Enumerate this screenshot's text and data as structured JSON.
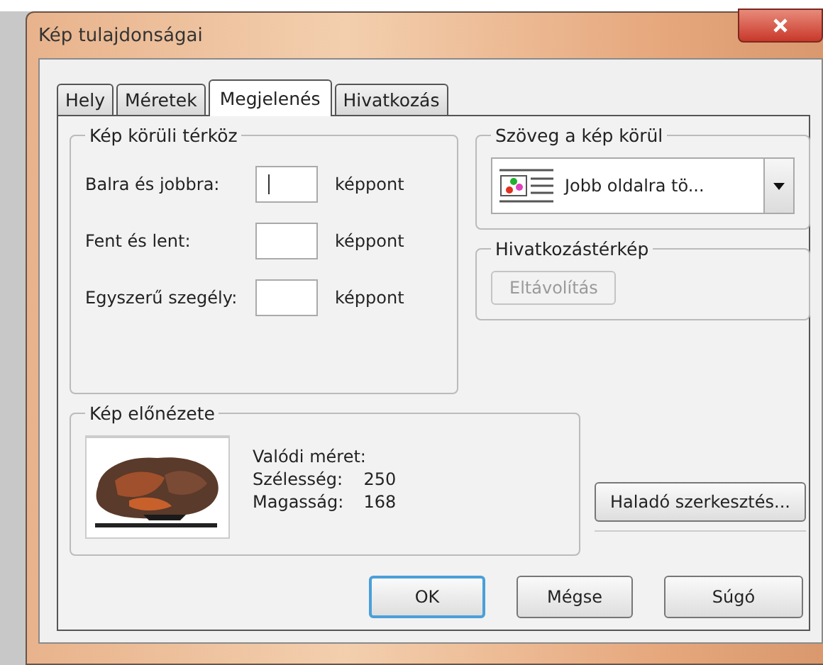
{
  "window": {
    "title": "Kép tulajdonságai"
  },
  "tabs": [
    {
      "label": "Hely",
      "selected": false
    },
    {
      "label": "Méretek",
      "selected": false
    },
    {
      "label": "Megjelenés",
      "selected": true
    },
    {
      "label": "Hivatkozás",
      "selected": false
    }
  ],
  "spacing_group": {
    "title": "Kép körüli térköz",
    "rows": [
      {
        "label": "Balra és jobbra:",
        "focused": true,
        "unit": "képpont"
      },
      {
        "label": "Fent és lent:",
        "focused": false,
        "unit": "képpont"
      },
      {
        "label": "Egyszerű szegély:",
        "focused": false,
        "unit": "képpont"
      }
    ]
  },
  "wrap_group": {
    "title": "Szöveg a kép körül",
    "dropdown_value": "Jobb oldalra tö..."
  },
  "imagemap_group": {
    "title": "Hivatkozástérkép",
    "button": {
      "label": "Eltávolítás",
      "disabled": true
    }
  },
  "preview_group": {
    "title": "Kép előnézete",
    "real_size_label": "Valódi méret:",
    "fields": [
      {
        "label": "Szélesség:",
        "value": "250"
      },
      {
        "label": "Magasság:",
        "value": "168"
      }
    ]
  },
  "advanced_button": "Haladó szerkesztés...",
  "buttons": [
    {
      "label": "OK",
      "default": true
    },
    {
      "label": "Mégse",
      "default": false
    },
    {
      "label": "Súgó",
      "default": false
    }
  ]
}
